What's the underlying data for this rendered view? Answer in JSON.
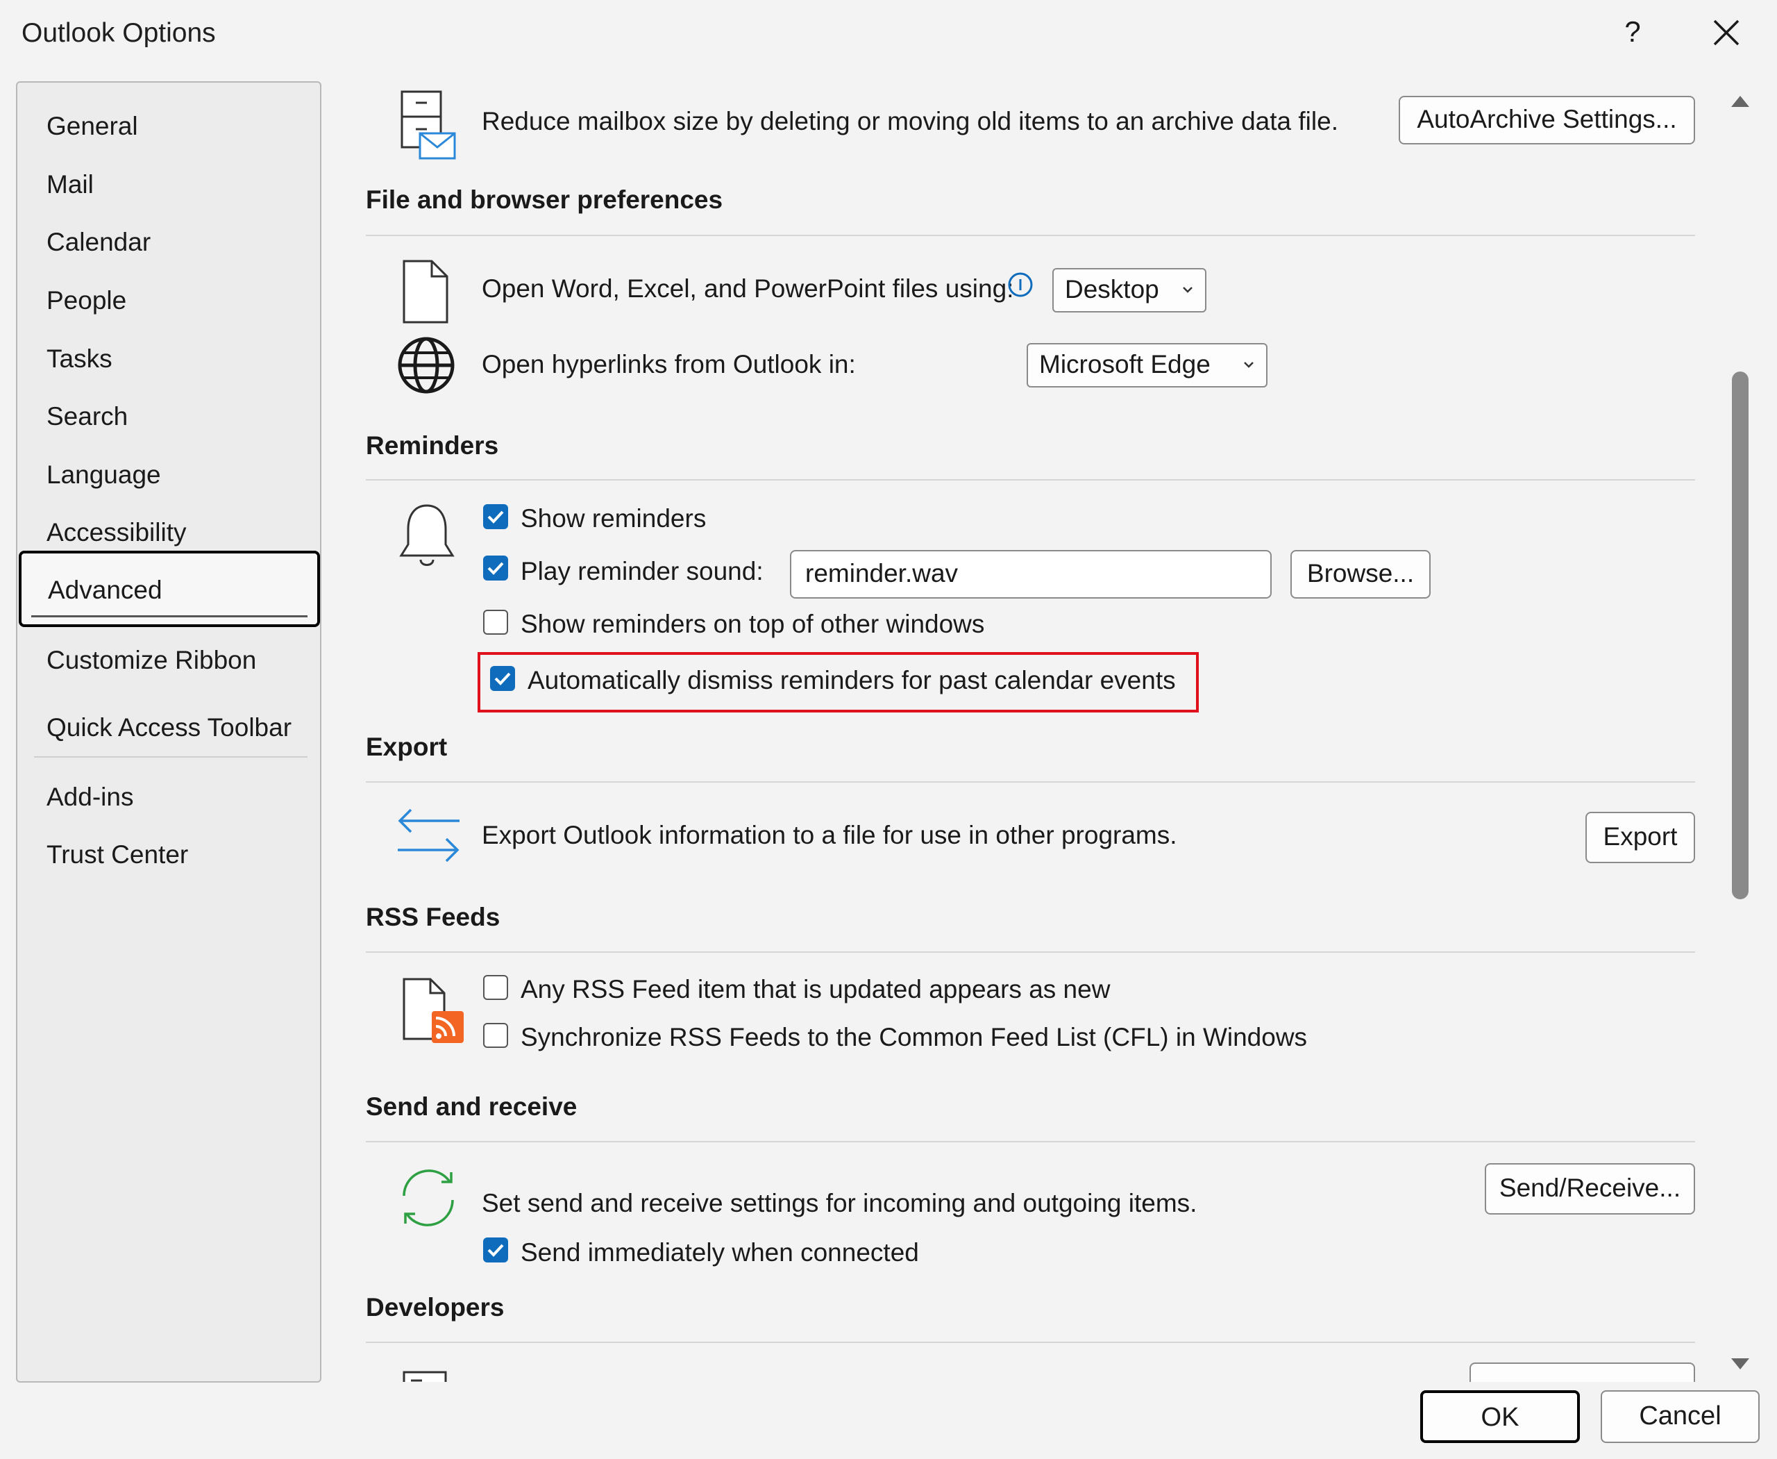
{
  "window": {
    "title": "Outlook Options",
    "help_label": "?"
  },
  "sidebar": {
    "items": [
      {
        "label": "General"
      },
      {
        "label": "Mail"
      },
      {
        "label": "Calendar"
      },
      {
        "label": "People"
      },
      {
        "label": "Tasks"
      },
      {
        "label": "Search"
      },
      {
        "label": "Language"
      },
      {
        "label": "Accessibility"
      },
      {
        "label": "Advanced",
        "selected": true
      },
      {
        "label": "Customize Ribbon"
      },
      {
        "label": "Quick Access Toolbar"
      },
      {
        "label": "Add-ins"
      },
      {
        "label": "Trust Center"
      }
    ]
  },
  "archive": {
    "description": "Reduce mailbox size by deleting or moving old items to an archive data file.",
    "button": "AutoArchive Settings..."
  },
  "file_browser": {
    "heading": "File and browser preferences",
    "open_files_label": "Open Word, Excel, and PowerPoint files using:",
    "open_files_value": "Desktop",
    "hyperlinks_label": "Open hyperlinks from Outlook in:",
    "hyperlinks_value": "Microsoft Edge"
  },
  "reminders": {
    "heading": "Reminders",
    "show_reminders": {
      "label": "Show reminders",
      "checked": true
    },
    "play_sound": {
      "label": "Play reminder sound:",
      "checked": true
    },
    "sound_file": "reminder.wav",
    "browse_button": "Browse...",
    "on_top": {
      "label": "Show reminders on top of other windows",
      "checked": false
    },
    "auto_dismiss": {
      "label": "Automatically dismiss reminders for past calendar events",
      "checked": true
    }
  },
  "export": {
    "heading": "Export",
    "description": "Export Outlook information to a file for use in other programs.",
    "button": "Export"
  },
  "rss": {
    "heading": "RSS Feeds",
    "updated_new": {
      "label": "Any RSS Feed item that is updated appears as new",
      "checked": false
    },
    "sync_cfl": {
      "label": "Synchronize RSS Feeds to the Common Feed List (CFL) in Windows",
      "checked": false
    }
  },
  "send_receive": {
    "heading": "Send and receive",
    "description": "Set send and receive settings for incoming and outgoing items.",
    "button": "Send/Receive...",
    "send_immediately": {
      "label": "Send immediately when connected",
      "checked": true
    }
  },
  "developers": {
    "heading": "Developers"
  },
  "footer": {
    "ok": "OK",
    "cancel": "Cancel"
  },
  "colors": {
    "accent": "#0f6cbd",
    "highlight": "#e0101c",
    "export_arrows": "#2b88d8",
    "sync_arrows": "#2ea043",
    "rss_orange": "#f26522"
  }
}
